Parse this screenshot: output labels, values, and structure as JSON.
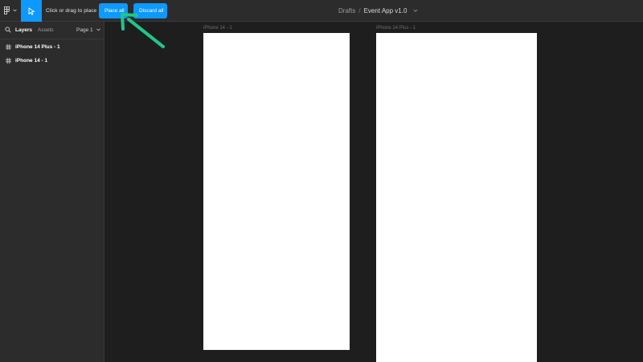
{
  "toolbar": {
    "hint": "Click or drag to place",
    "place_all_label": "Place all",
    "discard_all_label": "Discard all",
    "breadcrumb_project": "Drafts",
    "breadcrumb_separator": "/",
    "file_name": "Event App v1.0"
  },
  "left_panel": {
    "tabs": [
      {
        "label": "Layers",
        "active": true
      },
      {
        "label": "Assets",
        "active": false
      }
    ],
    "page_selector": "Page 1",
    "layers": [
      {
        "label": "iPhone 14 Plus - 1",
        "icon": "frame-icon"
      },
      {
        "label": "iPhone 14 - 1",
        "icon": "frame-icon"
      }
    ]
  },
  "canvas": {
    "frames": [
      {
        "label": "iPhone 14 - 1"
      },
      {
        "label": "iPhone 14 Plus - 1"
      }
    ]
  },
  "colors": {
    "accent": "#0d99ff",
    "toolbar_bg": "#2c2c2c",
    "canvas_bg": "#1e1e1e",
    "annotation_arrow": "#1fc78a"
  },
  "icons": [
    "figma-menu-icon",
    "move-tool-icon",
    "search-icon",
    "frame-icon",
    "chevron-down-icon"
  ]
}
